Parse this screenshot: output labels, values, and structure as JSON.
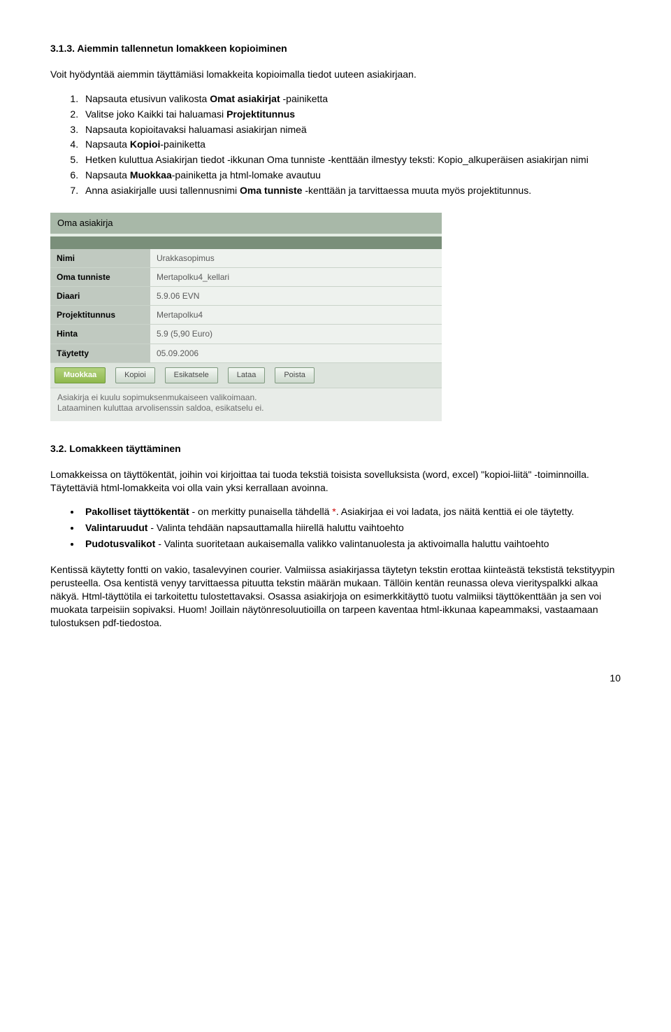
{
  "section1": {
    "heading": "3.1.3. Aiemmin tallennetun lomakkeen kopioiminen",
    "intro": "Voit hyödyntää aiemmin täyttämiäsi lomakkeita kopioimalla tiedot uuteen asiakirjaan.",
    "steps": [
      {
        "pre": "Napsauta etusivun valikosta ",
        "b": "Omat asiakirjat",
        "post": " -painiketta"
      },
      {
        "pre": "Valitse joko Kaikki tai haluamasi ",
        "b": "Projektitunnus",
        "post": ""
      },
      {
        "pre": "Napsauta kopioitavaksi haluamasi asiakirjan nimeä",
        "b": "",
        "post": ""
      },
      {
        "pre": "Napsauta ",
        "b": "Kopioi",
        "post": "-painiketta"
      },
      {
        "pre": "Hetken kuluttua Asiakirjan tiedot -ikkunan Oma tunniste -kenttään ilmestyy teksti: Kopio_alkuperäisen asiakirjan nimi",
        "b": "",
        "post": ""
      },
      {
        "pre": "Napsauta ",
        "b": "Muokkaa",
        "post": "-painiketta ja html-lomake avautuu"
      },
      {
        "pre": "Anna asiakirjalle uusi tallennusnimi ",
        "b": "Oma tunniste",
        "post": " -kenttään ja tarvittaessa muuta myös projektitunnus."
      }
    ]
  },
  "embed": {
    "title": "Oma asiakirja",
    "rows": [
      {
        "label": "Nimi",
        "value": "Urakkasopimus"
      },
      {
        "label": "Oma tunniste",
        "value": "Mertapolku4_kellari"
      },
      {
        "label": "Diaari",
        "value": "5.9.06 EVN"
      },
      {
        "label": "Projektitunnus",
        "value": "Mertapolku4"
      },
      {
        "label": "Hinta",
        "value": "5.9 (5,90 Euro)"
      },
      {
        "label": "Täytetty",
        "value": "05.09.2006"
      }
    ],
    "buttons": [
      "Muokkaa",
      "Kopioi",
      "Esikatsele",
      "Lataa",
      "Poista"
    ],
    "note1": "Asiakirja ei kuulu sopimuksenmukaiseen valikoimaan.",
    "note2": "Lataaminen kuluttaa arvolisenssin saldoa, esikatselu ei."
  },
  "section2": {
    "heading": "3.2. Lomakkeen täyttäminen",
    "para1": "Lomakkeissa on täyttökentät, joihin voi kirjoittaa tai tuoda tekstiä toisista sovelluksista (word, excel) \"kopioi-liitä\" -toiminnoilla. Täytettäviä html-lomakkeita voi olla vain yksi kerrallaan avoinna.",
    "bullets": [
      {
        "b": "Pakolliset täyttökentät",
        "post": " - on merkitty punaisella tähdellä ",
        "star": "*",
        "tail": ". Asiakirjaa ei voi ladata, jos näitä kenttiä ei ole täytetty."
      },
      {
        "b": "Valintaruudut",
        "post": " - Valinta tehdään napsauttamalla hiirellä haluttu vaihtoehto",
        "star": "",
        "tail": ""
      },
      {
        "b": "Pudotusvalikot",
        "post": " - Valinta suoritetaan aukaisemalla valikko valintanuolesta ja aktivoimalla haluttu vaihtoehto",
        "star": "",
        "tail": ""
      }
    ],
    "para2": "Kentissä käytetty fontti on vakio, tasalevyinen courier. Valmiissa asiakirjassa täytetyn tekstin erottaa kiinteästä tekstistä tekstityypin perusteella. Osa kentistä venyy tarvittaessa pituutta tekstin määrän mukaan. Tällöin kentän reunassa oleva vierityspalkki alkaa näkyä. Html-täyttötila ei tarkoitettu tulostettavaksi. Osassa asiakirjoja on esimerkkitäyttö tuotu valmiiksi täyttökenttään ja sen voi muokata tarpeisiin sopivaksi. Huom! Joillain näytönresoluutioilla on tarpeen kaventaa html-ikkunaa kapeammaksi, vastaamaan tulostuksen pdf-tiedostoa."
  },
  "pageNumber": "10"
}
